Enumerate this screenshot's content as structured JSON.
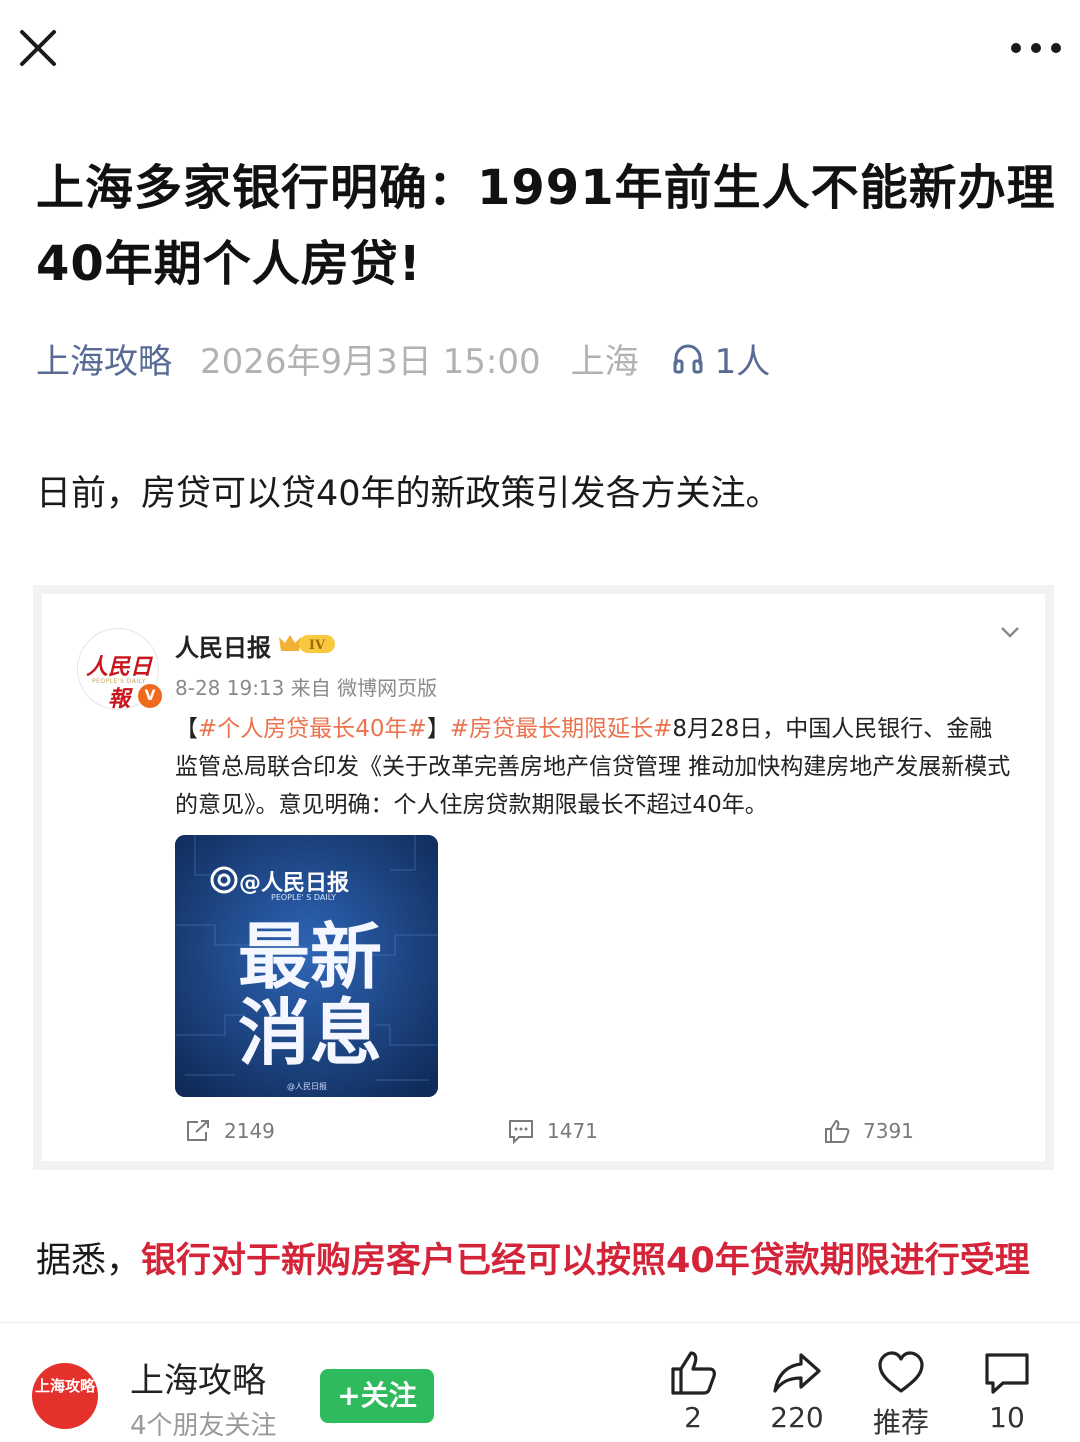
{
  "topbar": {
    "close_icon": "close-icon",
    "more_icon": "more-dots-icon"
  },
  "article": {
    "title": "上海多家银行明确：1991年前生人不能新办理40年期个人房贷!",
    "author": "上海攻略",
    "datetime": "2026年9月3日 15:00",
    "location": "上海",
    "listen_icon": "headphones-icon",
    "listeners": "1人",
    "para1": "日前，房贷可以贷40年的新政策引发各方关注。",
    "para2_prefix": "据悉，",
    "para2_highlight": "银行对于新购房客户已经可以按照40年贷款期限进行受理"
  },
  "weibo": {
    "avatar_logo": "人民日報",
    "avatar_logo_sub": "PEOPLE'S DAILY",
    "verified_badge": "V",
    "name": "人民日报",
    "rank_badge": "IV",
    "time": "8-28 19:13 来自 微博网页版",
    "text_open": "【",
    "tag1": "#个人房贷最长40年#",
    "text_close": "】",
    "tag2": "#房贷最长期限延长#",
    "text_body": "8月28日，中国人民银行、金融监管总局联合印发《关于改革完善房地产信贷管理 推动加快构建房地产发展新模式的意见》。意见明确：个人住房贷款期限最长不超过40年。",
    "image": {
      "brand": "@人民日报",
      "brand_sub": "PEOPLE' S DAILY",
      "line1": "最新",
      "line2": "消息",
      "watermark": "@人民日报"
    },
    "reposts": "2149",
    "comments": "1471",
    "likes": "7391"
  },
  "bottom": {
    "avatar_text": "上海攻略",
    "name": "上海攻略",
    "friends": "4个朋友关注",
    "follow_label": "+关注",
    "like_count": "2",
    "share_count": "220",
    "recommend_label": "推荐",
    "comment_count": "10"
  },
  "colors": {
    "link": "#576b95",
    "highlight": "#d4243a",
    "follow": "#2fbb5d",
    "tag": "#eb7350"
  }
}
